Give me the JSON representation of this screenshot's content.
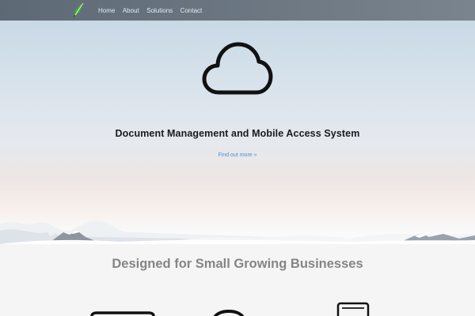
{
  "nav": {
    "logo_icon": "leaf-logo-icon",
    "links": [
      "Home",
      "About",
      "Solutions",
      "Contact"
    ]
  },
  "hero": {
    "icon": "cloud-icon",
    "title": "Document Management and Mobile Access System",
    "link_label": "Find out more »"
  },
  "features": {
    "title": "Designed for Small Growing Businesses",
    "icons": [
      "laptop-icon",
      "circle-icon",
      "tablet-icon"
    ]
  },
  "colors": {
    "navbar": "#6a7580",
    "link": "#4a8fd3",
    "section_title": "#858585",
    "background": "#f5f5f5"
  }
}
